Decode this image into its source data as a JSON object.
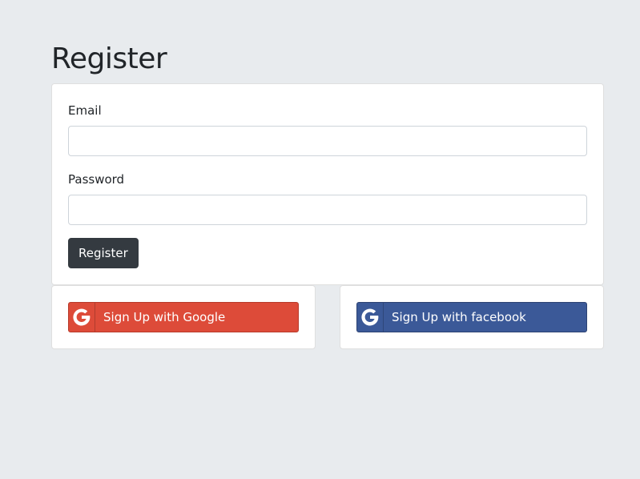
{
  "page": {
    "title": "Register"
  },
  "form": {
    "email_label": "Email",
    "email_value": "",
    "email_placeholder": "",
    "password_label": "Password",
    "password_value": "",
    "password_placeholder": "",
    "submit_label": "Register"
  },
  "social": {
    "google": {
      "label": "Sign Up with Google",
      "icon": "google-icon",
      "color": "#dd4b39"
    },
    "facebook": {
      "label": "Sign Up with facebook",
      "icon": "google-icon",
      "color": "#3b5998"
    }
  },
  "colors": {
    "background": "#e8ebee",
    "card": "#ffffff",
    "primary_button": "#343a40"
  }
}
